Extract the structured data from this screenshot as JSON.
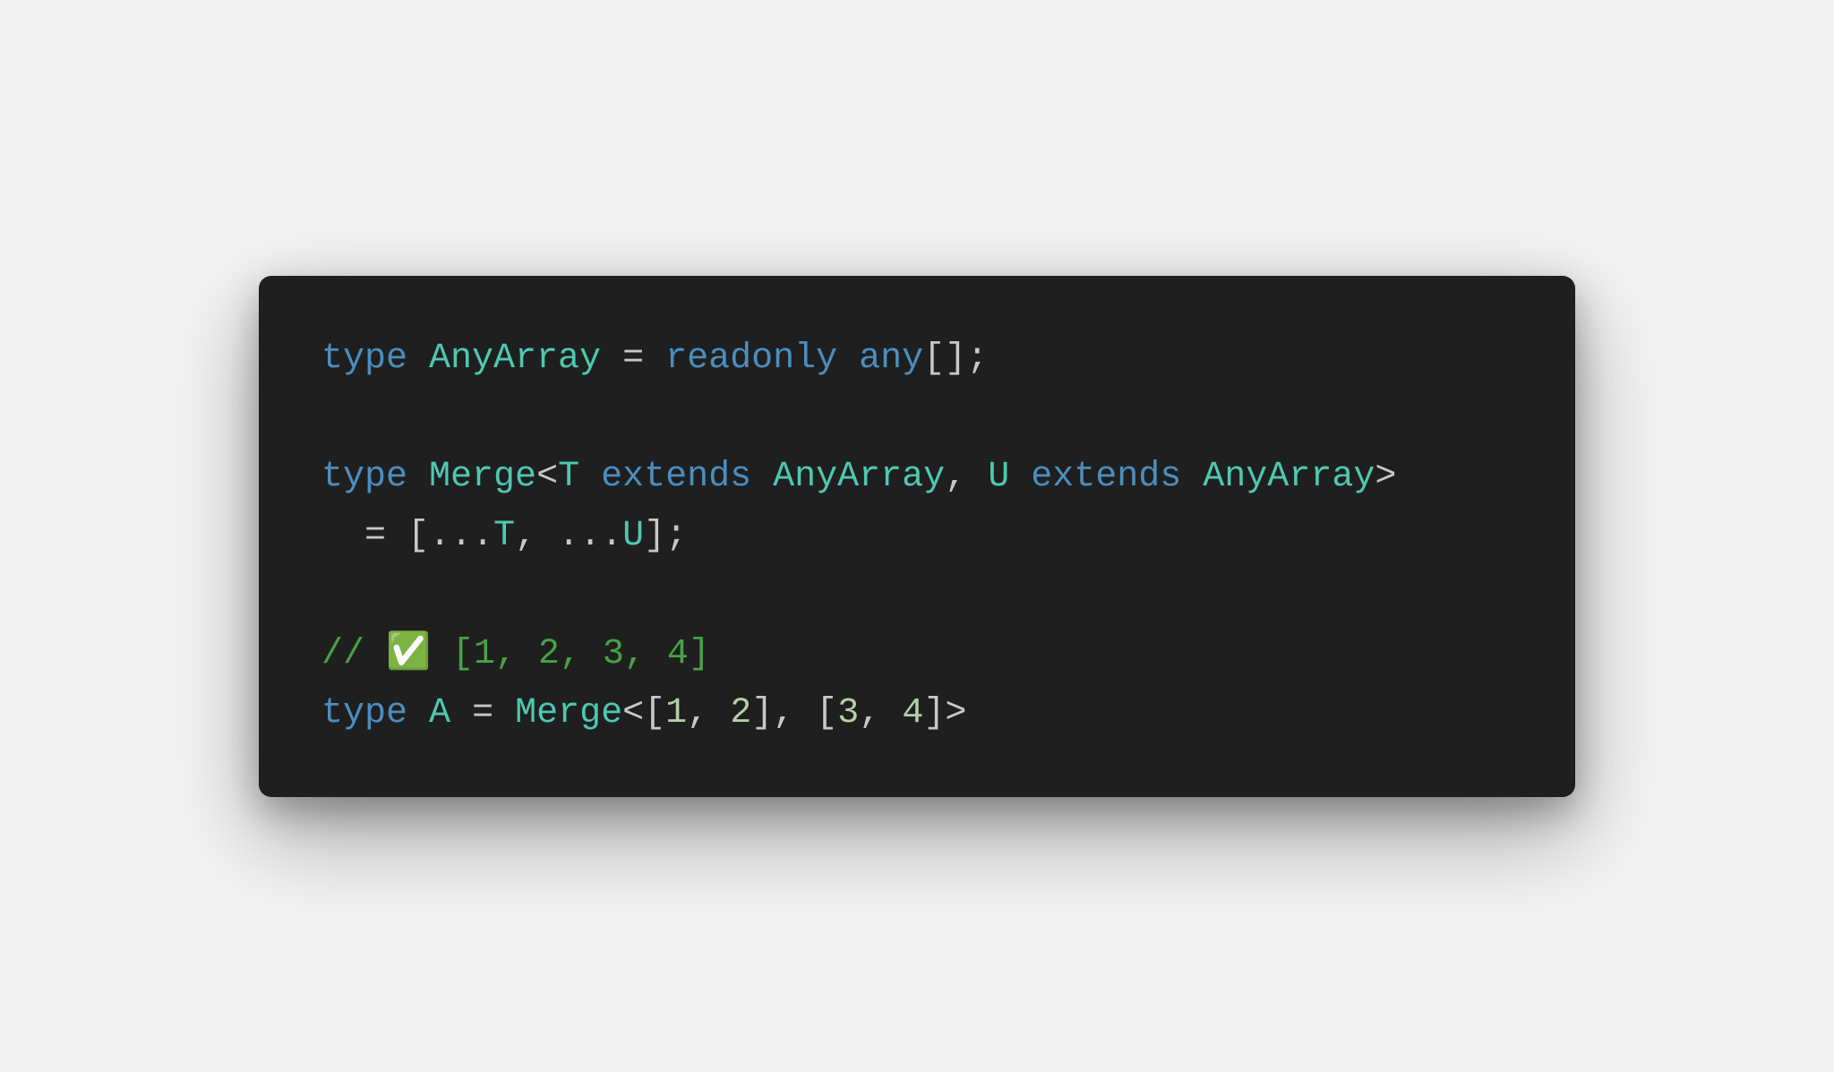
{
  "code": {
    "line1": {
      "kw_type": "type",
      "sp1": " ",
      "typename": "AnyArray",
      "sp2": " ",
      "eq": "=",
      "sp3": " ",
      "kw_readonly": "readonly",
      "sp4": " ",
      "kw_any": "any",
      "brackets": "[]",
      "semi": ";"
    },
    "line3": {
      "kw_type": "type",
      "sp1": " ",
      "typename": "Merge",
      "lt": "<",
      "T": "T",
      "sp2": " ",
      "kw_extends1": "extends",
      "sp3": " ",
      "anyarray1": "AnyArray",
      "comma": ",",
      "sp4": " ",
      "U": "U",
      "sp5": " ",
      "kw_extends2": "extends",
      "sp6": " ",
      "anyarray2": "AnyArray",
      "gt": ">"
    },
    "line4": {
      "indent": "  ",
      "eq": "=",
      "sp1": " ",
      "lbracket": "[",
      "spread1": "...",
      "T": "T",
      "comma": ",",
      "sp2": " ",
      "spread2": "...",
      "U": "U",
      "rbracket": "]",
      "semi": ";"
    },
    "line6": {
      "comment": "// ✅ [1, 2, 3, 4]"
    },
    "line7": {
      "kw_type": "type",
      "sp1": " ",
      "typename": "A",
      "sp2": " ",
      "eq": "=",
      "sp3": " ",
      "merge": "Merge",
      "lt": "<",
      "lb1": "[",
      "n1": "1",
      "c1": ",",
      "sp4": " ",
      "n2": "2",
      "rb1": "]",
      "c2": ",",
      "sp5": " ",
      "lb2": "[",
      "n3": "3",
      "c3": ",",
      "sp6": " ",
      "n4": "4",
      "rb2": "]",
      "gt": ">"
    }
  }
}
